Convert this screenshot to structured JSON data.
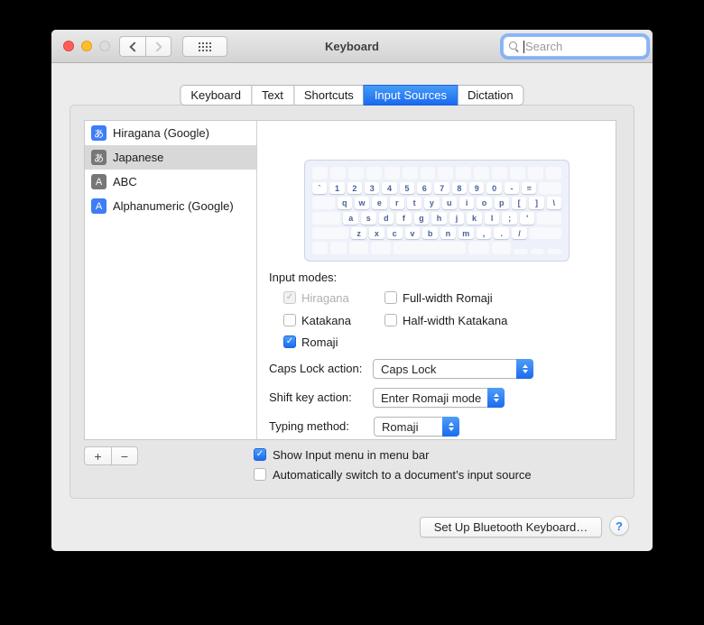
{
  "window": {
    "title": "Keyboard"
  },
  "toolbar": {
    "search_placeholder": "Search"
  },
  "tabs": [
    {
      "label": "Keyboard",
      "selected": false
    },
    {
      "label": "Text",
      "selected": false
    },
    {
      "label": "Shortcuts",
      "selected": false
    },
    {
      "label": "Input Sources",
      "selected": true
    },
    {
      "label": "Dictation",
      "selected": false
    }
  ],
  "sources": [
    {
      "label": "Hiragana (Google)",
      "icon": "あ",
      "icon_color": "#3d7df5",
      "selected": false
    },
    {
      "label": "Japanese",
      "icon": "あ",
      "icon_color": "#777777",
      "selected": true
    },
    {
      "label": "ABC",
      "icon": "A",
      "icon_color": "#777777",
      "selected": false
    },
    {
      "label": "Alphanumeric (Google)",
      "icon": "A",
      "icon_color": "#3d7df5",
      "selected": false
    }
  ],
  "input_modes": {
    "label": "Input modes:",
    "options": [
      {
        "label": "Hiragana",
        "checked": true,
        "disabled": true
      },
      {
        "label": "Katakana",
        "checked": false,
        "disabled": false
      },
      {
        "label": "Romaji",
        "checked": true,
        "disabled": false
      },
      {
        "label": "Full-width Romaji",
        "checked": false,
        "disabled": false
      },
      {
        "label": "Half-width Katakana",
        "checked": false,
        "disabled": false
      }
    ]
  },
  "dropdowns": [
    {
      "label": "Caps Lock action:",
      "value": "Caps Lock"
    },
    {
      "label": "Shift key action:",
      "value": "Enter Romaji mode"
    },
    {
      "label": "Typing method:",
      "value": "Romaji"
    }
  ],
  "bottom_checkboxes": [
    {
      "label": "Show Input menu in menu bar",
      "checked": true
    },
    {
      "label": "Automatically switch to a document’s input source",
      "checked": false
    }
  ],
  "buttons": {
    "add": "+",
    "remove": "−",
    "bluetooth": "Set Up Bluetooth Keyboard…",
    "help": "?"
  },
  "check_glyph": "✓",
  "colors": {
    "accent": "#2a7ff5",
    "selected_tab_top": "#459df6",
    "selected_tab_bottom": "#1a6af0",
    "key_text": "#46619c"
  },
  "keyboard_preview": {
    "rows": [
      [
        [
          "",
          1
        ],
        [
          "",
          1
        ],
        [
          "",
          1
        ],
        [
          "",
          1
        ],
        [
          "",
          1
        ],
        [
          "",
          1
        ],
        [
          "",
          1
        ],
        [
          "",
          1
        ],
        [
          "",
          1
        ],
        [
          "",
          1
        ],
        [
          "",
          1
        ],
        [
          "",
          1
        ],
        [
          "",
          1
        ],
        [
          "",
          1
        ]
      ],
      [
        [
          "`",
          1
        ],
        [
          "1",
          1
        ],
        [
          "2",
          1
        ],
        [
          "3",
          1
        ],
        [
          "4",
          1
        ],
        [
          "5",
          1
        ],
        [
          "6",
          1
        ],
        [
          "7",
          1
        ],
        [
          "8",
          1
        ],
        [
          "9",
          1
        ],
        [
          "0",
          1
        ],
        [
          "-",
          1
        ],
        [
          "=",
          1
        ],
        [
          "",
          1.5
        ]
      ],
      [
        [
          "",
          1.5
        ],
        [
          "q",
          1
        ],
        [
          "w",
          1
        ],
        [
          "e",
          1
        ],
        [
          "r",
          1
        ],
        [
          "t",
          1
        ],
        [
          "y",
          1
        ],
        [
          "u",
          1
        ],
        [
          "i",
          1
        ],
        [
          "o",
          1
        ],
        [
          "p",
          1
        ],
        [
          "[",
          1
        ],
        [
          "]",
          1
        ],
        [
          "\\",
          1
        ]
      ],
      [
        [
          "",
          1.9
        ],
        [
          "a",
          1
        ],
        [
          "s",
          1
        ],
        [
          "d",
          1
        ],
        [
          "f",
          1
        ],
        [
          "g",
          1
        ],
        [
          "h",
          1
        ],
        [
          "j",
          1
        ],
        [
          "k",
          1
        ],
        [
          "l",
          1
        ],
        [
          ";",
          1
        ],
        [
          "'",
          1
        ],
        [
          "",
          1.6
        ]
      ],
      [
        [
          "",
          2.4
        ],
        [
          "z",
          1
        ],
        [
          "x",
          1
        ],
        [
          "c",
          1
        ],
        [
          "v",
          1
        ],
        [
          "b",
          1
        ],
        [
          "n",
          1
        ],
        [
          "m",
          1
        ],
        [
          ",",
          1
        ],
        [
          ".",
          1
        ],
        [
          "/",
          1
        ],
        [
          "",
          2.1
        ]
      ],
      [
        [
          "",
          1
        ],
        [
          "",
          1
        ],
        [
          "",
          1.2
        ],
        [
          "",
          1.3
        ],
        [
          "",
          4.6
        ],
        [
          "",
          1.3
        ],
        [
          "",
          1.2
        ],
        [
          "",
          0.9,
          "h"
        ],
        [
          "",
          0.9,
          "h"
        ],
        [
          "",
          0.9,
          "h"
        ]
      ]
    ]
  }
}
